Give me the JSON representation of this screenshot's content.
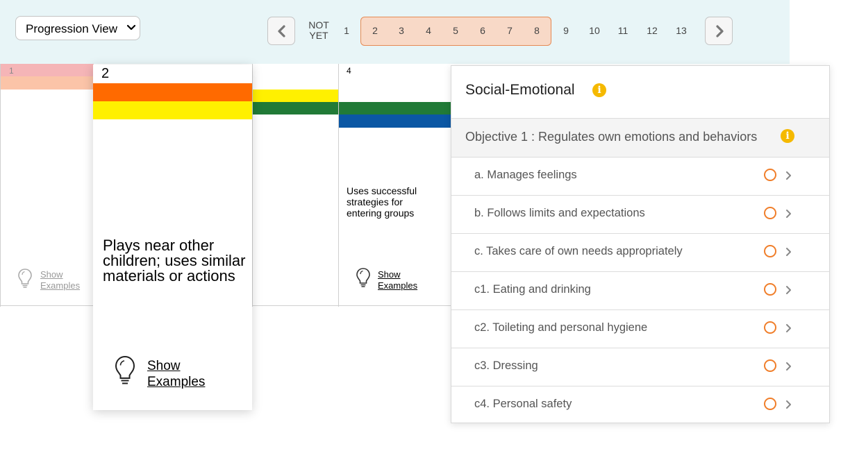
{
  "toolbar": {
    "view_select": "Progression View",
    "not_yet": [
      "NOT",
      "YET"
    ],
    "levels": [
      "1",
      "2",
      "3",
      "4",
      "5",
      "6",
      "7",
      "8",
      "9",
      "10",
      "11",
      "12",
      "13"
    ]
  },
  "grid": {
    "col1_num": "1",
    "col4_num": "4",
    "col4_desc": "Uses successful strategies for entering groups",
    "show_examples": [
      "Show",
      "Examples"
    ]
  },
  "card2": {
    "num": "2",
    "desc": "Plays near other children; uses similar materials or actions",
    "show_examples": [
      "Show",
      "Examples"
    ]
  },
  "panel": {
    "title": "Social-Emotional",
    "objective": "Objective 1 : Regulates own emotions and behaviors",
    "items": [
      "a. Manages feelings",
      "b. Follows limits and expectations",
      "c. Takes care of own needs appropriately",
      "c1. Eating and drinking",
      "c2. Toileting and personal hygiene",
      "c3. Dressing",
      "c4. Personal safety"
    ]
  },
  "colors": {
    "pink": "#f5b5b7",
    "peach": "#fbc4a8",
    "orange": "#ff6a00",
    "yellow": "#fff000",
    "green": "#217a37",
    "blue": "#0b57a4",
    "accent_range": "#f8d9c7",
    "status_circle": "#f07e2a",
    "info": "#f5b900"
  },
  "icons": [
    "chevron-down-icon",
    "chevron-left-icon",
    "chevron-right-icon",
    "lightbulb-icon",
    "info-icon",
    "circle-status-icon",
    "chevron-right-small-icon"
  ]
}
